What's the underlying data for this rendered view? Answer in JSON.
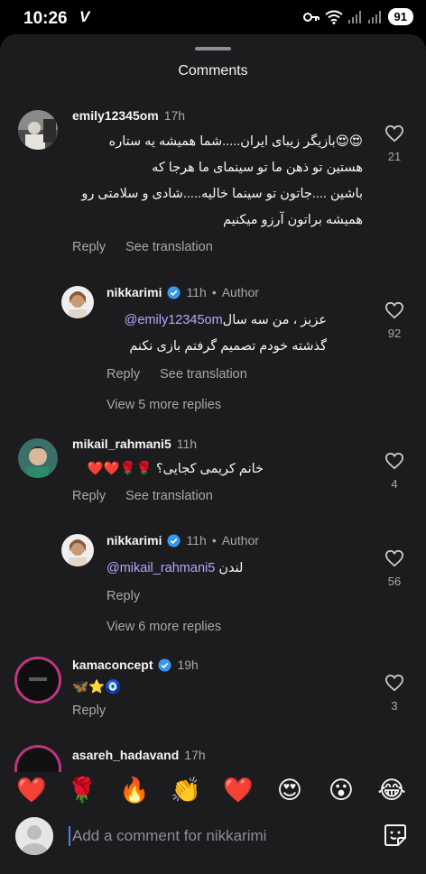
{
  "status": {
    "time": "10:26",
    "carrier_glyph": "V",
    "battery": "91"
  },
  "sheet": {
    "title": "Comments"
  },
  "comments": [
    {
      "username": "emily12345om",
      "time": "17h",
      "lines": [
        "😍😍بازیگر زیبای ایران.....شما همیشه یه ستاره",
        "هستین تو ذهن ما تو سینمای ما هرجا که",
        "باشین ....جاتون تو سینما خالیه.....شادی و سلامتی رو",
        "همیشه براتون آرزو میکنیم"
      ],
      "reply": "Reply",
      "translate": "See translation",
      "likes": "21"
    },
    {
      "username": "nikkarimi",
      "time": "11h",
      "author": "Author",
      "mention": "@emily12345om",
      "line1_rest": " عزیز ، من سه سال",
      "line2": "گذشته خودم تصمیم گرفتم بازی نکنم",
      "reply": "Reply",
      "translate": "See translation",
      "likes": "92",
      "more_replies": "View 5 more replies"
    },
    {
      "username": "mikail_rahmani5",
      "time": "11h",
      "text": "خانم کریمی کجایی؟ 🌹🌹❤️❤️",
      "reply": "Reply",
      "translate": "See translation",
      "likes": "4"
    },
    {
      "username": "nikkarimi",
      "time": "11h",
      "author": "Author",
      "mention": "@mikail_rahmani5",
      "text_rest": " لندن",
      "reply": "Reply",
      "likes": "56",
      "more_replies": "View 6 more replies"
    },
    {
      "username": "kamaconcept",
      "time": "19h",
      "text": "🦋⭐🧿",
      "reply": "Reply",
      "likes": "3"
    },
    {
      "username": "asareh_hadavand",
      "time": "17h"
    }
  ],
  "emoji_bar": [
    "❤️",
    "🌹",
    "🔥",
    "👏",
    "❤️",
    "😍",
    "😮",
    "😂"
  ],
  "composer": {
    "placeholder": "Add a comment for nikkarimi"
  }
}
